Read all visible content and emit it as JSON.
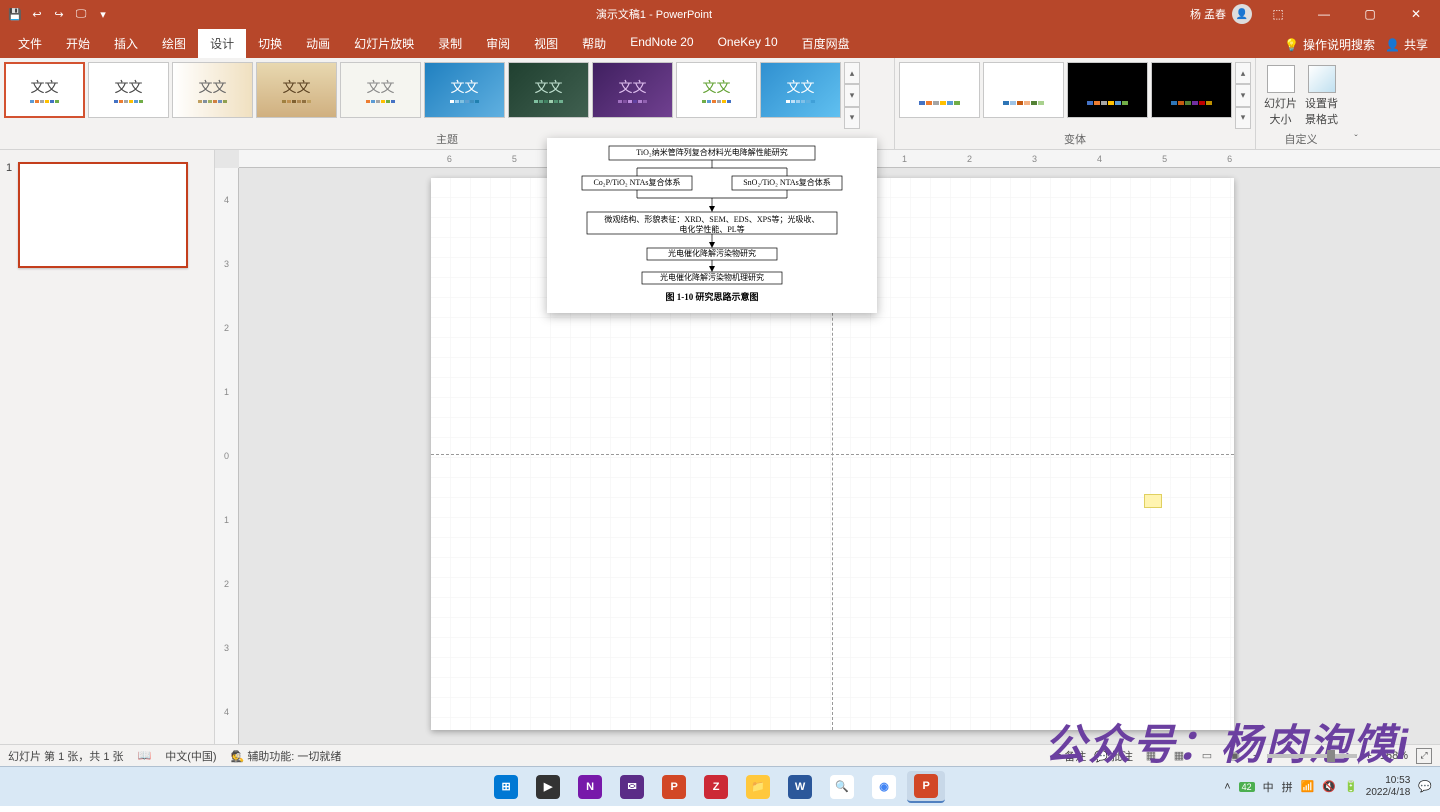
{
  "title": "演示文稿1 - PowerPoint",
  "user": "杨 孟春",
  "qa": [
    "💾",
    "↩",
    "↪",
    "🖵",
    "▾"
  ],
  "tabs": [
    "文件",
    "开始",
    "插入",
    "绘图",
    "设计",
    "切换",
    "动画",
    "幻灯片放映",
    "录制",
    "审阅",
    "视图",
    "帮助",
    "EndNote 20",
    "OneKey 10",
    "百度网盘"
  ],
  "active_tab": 4,
  "tell_me": "操作说明搜索",
  "share": "共享",
  "ribbon": {
    "themes_label": "主题",
    "variants_label": "变体",
    "custom_label": "自定义",
    "slide_size": "幻灯片\n大小",
    "bg_format": "设置背\n景格式",
    "themes": [
      {
        "bg": "#fff",
        "fg": "#444",
        "bars": [
          "#5B9BD5",
          "#ED7D31",
          "#A5A5A5",
          "#FFC000",
          "#4472C4",
          "#70AD47"
        ]
      },
      {
        "bg": "#fff",
        "fg": "#444",
        "bars": [
          "#4472C4",
          "#ED7D31",
          "#A5A5A5",
          "#FFC000",
          "#5B9BD5",
          "#70AD47"
        ]
      },
      {
        "bg": "linear-gradient(90deg,#fff,#f0e0c0)",
        "fg": "#666",
        "bars": [
          "#c0a060",
          "#8090a0",
          "#a0b060",
          "#d08040",
          "#7090c0",
          "#90a050"
        ]
      },
      {
        "bg": "linear-gradient(180deg,#e8d8b0,#d0b080)",
        "fg": "#5a4020",
        "bars": [
          "#a08040",
          "#c09050",
          "#806030",
          "#b08850",
          "#907040",
          "#c0a060"
        ]
      },
      {
        "bg": "#f5f5f0",
        "fg": "#888",
        "bars": [
          "#ED7D31",
          "#5B9BD5",
          "#A5A5A5",
          "#FFC000",
          "#70AD47",
          "#4472C4"
        ]
      },
      {
        "bg": "linear-gradient(135deg,#2080c0,#60b0e0)",
        "fg": "#fff",
        "bars": [
          "#fff",
          "#a0d0f0",
          "#80c0e0",
          "#60a0d0",
          "#4090c0",
          "#2080b0"
        ]
      },
      {
        "bg": "linear-gradient(135deg,#204030,#406050)",
        "fg": "#c0e0d0",
        "bars": [
          "#80c0a0",
          "#60a080",
          "#408060",
          "#a0d0b0",
          "#509070",
          "#70b090"
        ]
      },
      {
        "bg": "linear-gradient(135deg,#402060,#704090)",
        "fg": "#e0c0f0",
        "bars": [
          "#a070c0",
          "#8050a0",
          "#c090e0",
          "#6040a0",
          "#b080d0",
          "#9060b0"
        ]
      },
      {
        "bg": "#fff",
        "fg": "#60a030",
        "bars": [
          "#70AD47",
          "#5B9BD5",
          "#ED7D31",
          "#A5A5A5",
          "#FFC000",
          "#4472C4"
        ]
      },
      {
        "bg": "linear-gradient(135deg,#3090d0,#60c0f0)",
        "fg": "#fff",
        "bars": [
          "#fff",
          "#c0e0f8",
          "#a0d0f0",
          "#80c0e8",
          "#60b0e0",
          "#40a0d8"
        ]
      }
    ],
    "variants": [
      {
        "bg": "#fff",
        "bars": [
          "#4472C4",
          "#ED7D31",
          "#A5A5A5",
          "#FFC000",
          "#5B9BD5",
          "#70AD47"
        ]
      },
      {
        "bg": "#fff",
        "bars": [
          "#2E75B6",
          "#9DC3E6",
          "#C55A11",
          "#F4B183",
          "#548235",
          "#A9D18E"
        ]
      },
      {
        "bg": "#000",
        "bars": [
          "#4472C4",
          "#ED7D31",
          "#A5A5A5",
          "#FFC000",
          "#5B9BD5",
          "#70AD47"
        ]
      },
      {
        "bg": "#000",
        "bars": [
          "#2E75B6",
          "#C55A11",
          "#548235",
          "#7030A0",
          "#C00000",
          "#BF9000"
        ]
      }
    ]
  },
  "slides": {
    "current": "1",
    "total": "1"
  },
  "diagram": {
    "n1": "TiO₂纳米管阵列复合材料光电降解性能研究",
    "n2": "Co₂P/TiO₂ NTAs复合体系",
    "n3": "SnO₂/TiO₂ NTAs复合体系",
    "n4a": "微观结构、形貌表征：XRD、SEM、EDS、XPS等；光吸收、",
    "n4b": "电化学性能、PL等",
    "n5": "光电催化降解污染物研究",
    "n6": "光电催化降解污染物机理研究",
    "cap": "图 1-10  研究思路示意图"
  },
  "status": {
    "slide": "幻灯片 第 1 张，共 1 张",
    "lang": "中文(中国)",
    "acc": "辅助功能: 一切就绪",
    "notes": "备注",
    "comments": "批注",
    "zoom": "168%"
  },
  "watermark": "公众号：杨肉泡馍i",
  "tray": {
    "badge": "42",
    "ime1": "中",
    "ime2": "拼",
    "time": "10:53",
    "date": "2022/4/18"
  },
  "chart_data": {
    "type": "line",
    "title": "图 1-10  研究思路示意图",
    "note": "flowchart, not a data chart"
  }
}
